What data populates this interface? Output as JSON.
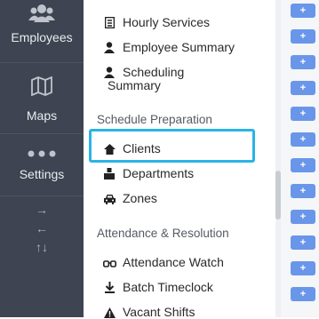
{
  "sidebar": {
    "items": [
      {
        "label": "Employees",
        "icon": "users-icon"
      },
      {
        "label": "Maps",
        "icon": "map-icon"
      },
      {
        "label": "Settings",
        "icon": "more-dots-icon"
      }
    ],
    "arrows": [
      "→",
      "←",
      "↑↓"
    ]
  },
  "menu": {
    "reports_items": [
      {
        "label": "Hourly Services",
        "icon": "document-icon"
      },
      {
        "label": "Employee Summary",
        "icon": "user-icon"
      },
      {
        "label": "Scheduling",
        "label2": "Summary",
        "icon": "user-icon"
      }
    ],
    "schedule_header": "Schedule Preparation",
    "schedule_items": [
      {
        "label": "Clients",
        "icon": "home-icon",
        "highlighted": true
      },
      {
        "label": "Departments",
        "icon": "building-icon"
      },
      {
        "label": "Zones",
        "icon": "car-icon"
      }
    ],
    "attendance_header": "Attendance & Resolution",
    "attendance_items": [
      {
        "label": "Attendance Watch",
        "icon": "glasses-icon"
      },
      {
        "label": "Batch Timeclock",
        "icon": "download-icon"
      },
      {
        "label": "Vacant Shifts",
        "icon": "warning-icon"
      }
    ]
  },
  "right_buttons": {
    "label": "+",
    "count": 12
  },
  "colors": {
    "sidebar": "#3e4451",
    "highlight": "#29b4e6",
    "button": "#6a96ea"
  }
}
